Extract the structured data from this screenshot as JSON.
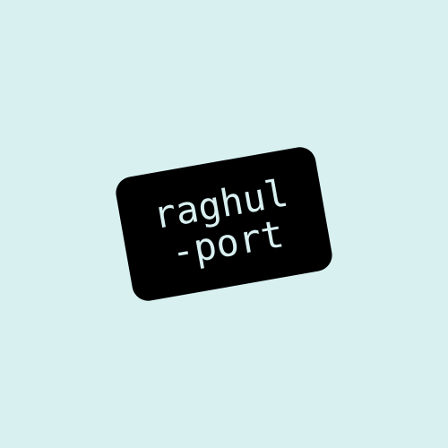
{
  "logo": {
    "line1": "raghul",
    "line2": "-port"
  },
  "colors": {
    "background": "#d9f0f1",
    "card": "#000000",
    "text": "#d9f0f1"
  }
}
